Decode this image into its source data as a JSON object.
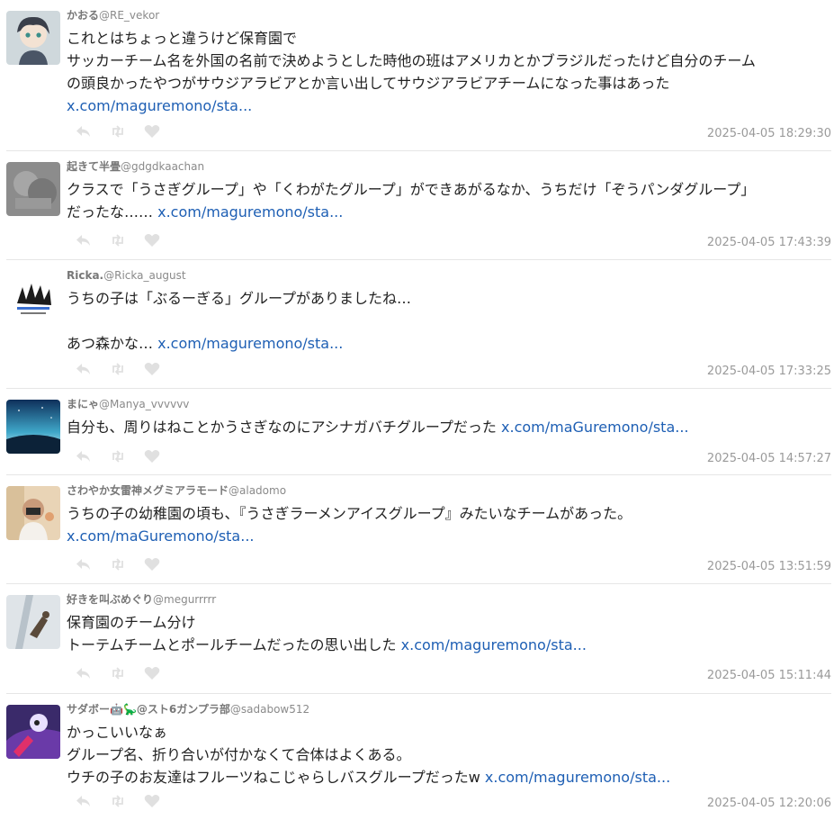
{
  "tweets": [
    {
      "name": "かおる",
      "handle": "@RE_vekor",
      "lines": [
        "これとはちょっと違うけど保育園で",
        "サッカーチーム名を外国の名前で決めようとした時他の班はアメリカとかブラジルだったけど自分のチーム",
        "の頭良かったやつがサウジアラビアとか言い出してサウジアラビアチームになった事はあった"
      ],
      "link": "x.com/maguremono/sta...",
      "time": "2025-04-05 18:29:30"
    },
    {
      "name": "起きて半畳",
      "handle": "@gdgdkaachan",
      "lines": [
        "クラスで「うさぎグループ」や「くわがたグループ」ができあがるなか、うちだけ「ぞうパンダグループ」",
        "だったな……"
      ],
      "link": "x.com/maguremono/sta...",
      "time": "2025-04-05 17:43:39"
    },
    {
      "name": "Ricka.",
      "handle": "@Ricka_august",
      "lines": [
        "うちの子は「ぶるーぎる」グループがありましたね…",
        "",
        "あつ森かな…"
      ],
      "link": "x.com/maguremono/sta...",
      "time": "2025-04-05 17:33:25"
    },
    {
      "name": "まにゃ",
      "handle": "@Manya_vvvvvv",
      "lines": [
        "自分も、周りはねことかうさぎなのにアシナガバチグループだった"
      ],
      "link": "x.com/maGuremono/sta...",
      "time": "2025-04-05 14:57:27"
    },
    {
      "name": "さわやか女雷神メグミアラモード",
      "handle": "@aladomo",
      "lines": [
        "うちの子の幼稚園の頃も、『うさぎラーメンアイスグループ』みたいなチームがあった。",
        ""
      ],
      "link": "x.com/maGuremono/sta...",
      "time": "2025-04-05 13:51:59"
    },
    {
      "name": "好きを叫ぶめぐり",
      "handle": "@megurrrrr",
      "lines": [
        "保育園のチーム分け",
        "トーテムチームとポールチームだったの思い出した"
      ],
      "link": "x.com/maguremono/sta...",
      "time": "2025-04-05 15:11:44"
    },
    {
      "name": "サダボー🤖🦕@スト6ガンプラ部",
      "handle": "@sadabow512",
      "lines": [
        "かっこいいなぁ",
        "グループ名、折り合いが付かなくて合体はよくある。",
        "ウチの子のお友達はフルーツねこじゃらしバスグループだったw"
      ],
      "link": "x.com/maguremono/sta...",
      "time": "2025-04-05 12:20:06"
    }
  ],
  "icons": {
    "reply": "reply-icon",
    "retweet": "retweet-icon",
    "like": "heart-icon"
  },
  "colors": {
    "link": "#1e5fb4",
    "name": "#777777",
    "timestamp": "#9a9a9a",
    "action_icon": "#e0e0e0",
    "divider": "#e6e6e6"
  }
}
